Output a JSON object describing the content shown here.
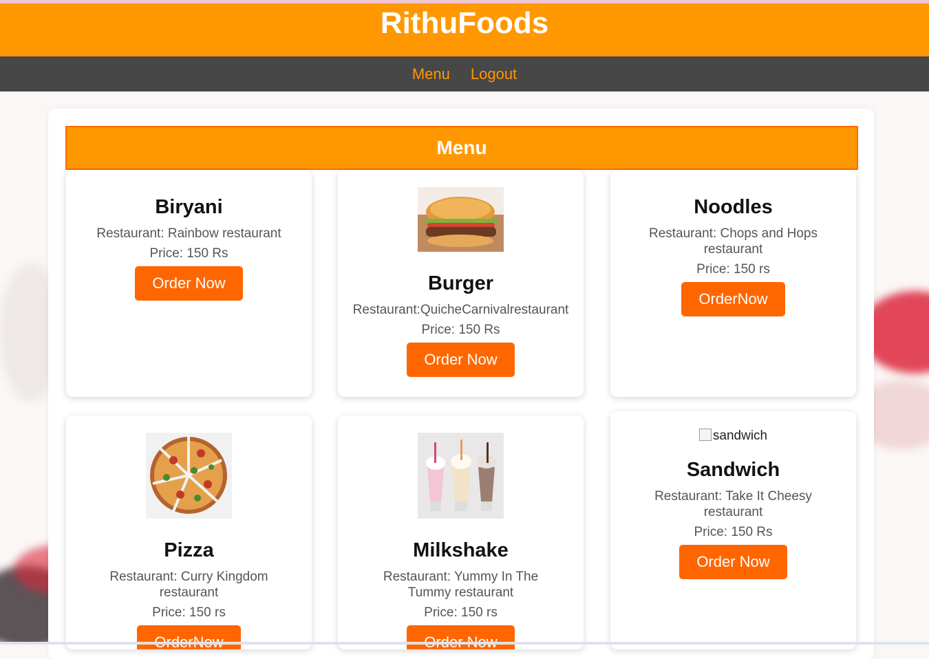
{
  "app": {
    "title": "RithuFoods"
  },
  "nav": {
    "items": [
      {
        "label": "Menu"
      },
      {
        "label": "Logout"
      }
    ]
  },
  "menu": {
    "heading": "Menu",
    "items": [
      {
        "name": "Biryani",
        "restaurant": "Restaurant: Rainbow restaurant",
        "price": "Price: 150 Rs",
        "button": "Order Now"
      },
      {
        "name": "Burger",
        "image_alt": "burger",
        "restaurant": "Restaurant:QuicheCarnivalrestaurant",
        "price": "Price: 150 Rs",
        "button": "Order Now"
      },
      {
        "name": "Noodles",
        "restaurant": "Restaurant: Chops and Hops restaurant",
        "price": "Price: 150 rs",
        "button": "OrderNow"
      },
      {
        "name": "Pizza",
        "image_alt": "pizza",
        "restaurant": "Restaurant: Curry Kingdom restaurant",
        "price": "Price: 150 rs",
        "button": "OrderNow"
      },
      {
        "name": "Milkshake",
        "image_alt": "milkshake",
        "restaurant": "Restaurant: Yummy In The Tummy restaurant",
        "price": "Price: 150 rs",
        "button": "Order Now"
      },
      {
        "name": "Sandwich",
        "image_alt": "sandwich",
        "restaurant": "Restaurant: Take It Cheesy restaurant",
        "price": "Price: 150 Rs",
        "button": "Order Now"
      }
    ]
  },
  "colors": {
    "header": "#ff9800",
    "nav_bg": "#474747",
    "nav_link": "#ff9800",
    "button": "#ff6600"
  }
}
